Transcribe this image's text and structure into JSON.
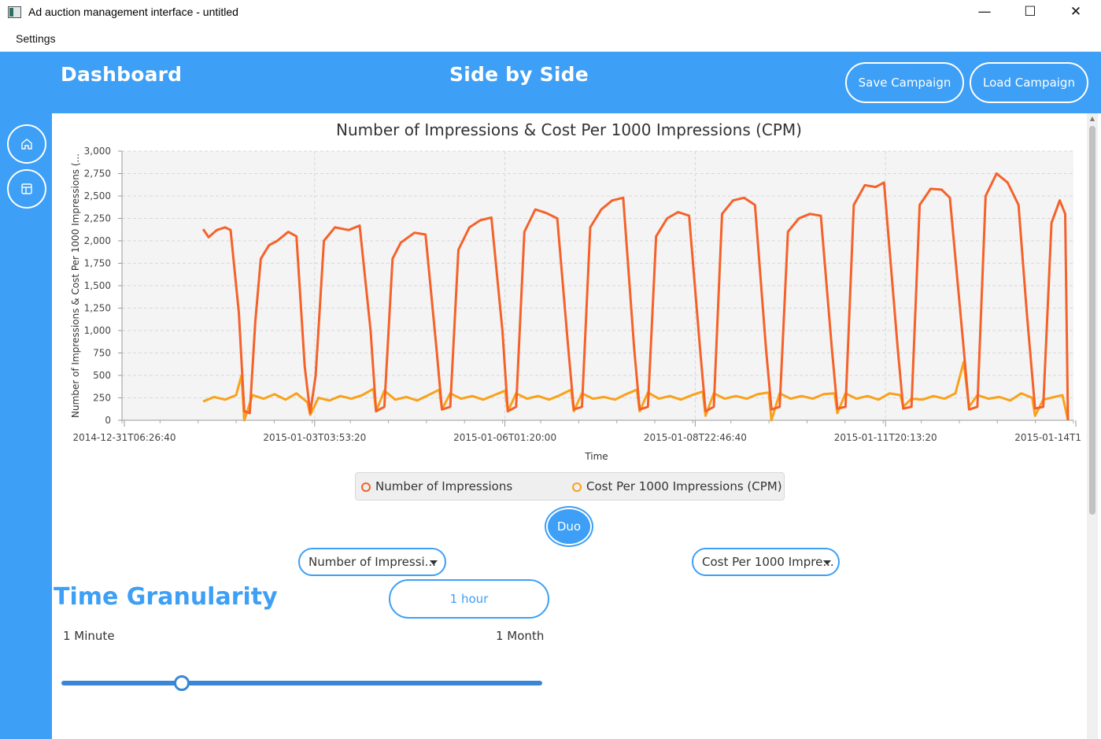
{
  "window": {
    "title": "Ad auction management interface - untitled",
    "minimize": "—",
    "maximize": "☐",
    "close": "✕"
  },
  "menu": {
    "settings": "Settings"
  },
  "header": {
    "left_title": "Dashboard",
    "center_title": "Side by Side",
    "save_label": "Save Campaign",
    "load_label": "Load Campaign"
  },
  "sidebar": {
    "items": [
      {
        "icon": "home-icon"
      },
      {
        "icon": "layout-icon"
      }
    ]
  },
  "chart_data": {
    "type": "line",
    "title": "Number of Impressions & Cost Per 1000 Impressions (CPM)",
    "xlabel": "Time",
    "ylabel": "Number of Impressions & Cost Per 1000 Impressions (...",
    "ylim": [
      0,
      3000
    ],
    "yticks": [
      0,
      250,
      500,
      750,
      1000,
      1250,
      1500,
      1750,
      2000,
      2250,
      2500,
      2750,
      3000
    ],
    "ytick_labels": [
      "0",
      "250",
      "500",
      "750",
      "1,000",
      "1,250",
      "1,500",
      "1,750",
      "2,000",
      "2,250",
      "2,500",
      "2,750",
      "3,000"
    ],
    "xlim": [
      "2014-12-31T06:26:40",
      "2015-01-14T17:00:00"
    ],
    "xtick_labels": [
      "2014-12-31T06:26:40",
      "2015-01-03T03:53:20",
      "2015-01-06T01:20:00",
      "2015-01-08T22:46:40",
      "2015-01-11T20:13:20",
      "2015-01-14T1"
    ],
    "grid": true,
    "legend_position": "bottom",
    "series": [
      {
        "name": "Number of Impressions",
        "color": "#f4622a",
        "points": [
          [
            "2015-01-01T12:00",
            2130
          ],
          [
            "2015-01-01T14:00",
            2040
          ],
          [
            "2015-01-01T17:00",
            2120
          ],
          [
            "2015-01-01T20:00",
            2150
          ],
          [
            "2015-01-01T22:00",
            2120
          ],
          [
            "2015-01-02T01:00",
            1200
          ],
          [
            "2015-01-02T03:00",
            100
          ],
          [
            "2015-01-02T05:00",
            80
          ],
          [
            "2015-01-02T07:00",
            1100
          ],
          [
            "2015-01-02T09:00",
            1800
          ],
          [
            "2015-01-02T12:00",
            1950
          ],
          [
            "2015-01-02T15:00",
            2000
          ],
          [
            "2015-01-02T19:00",
            2100
          ],
          [
            "2015-01-02T22:00",
            2050
          ],
          [
            "2015-01-03T01:00",
            600
          ],
          [
            "2015-01-03T03:00",
            80
          ],
          [
            "2015-01-03T05:00",
            500
          ],
          [
            "2015-01-03T08:00",
            2000
          ],
          [
            "2015-01-03T12:00",
            2150
          ],
          [
            "2015-01-03T17:00",
            2120
          ],
          [
            "2015-01-03T21:00",
            2170
          ],
          [
            "2015-01-04T01:00",
            1000
          ],
          [
            "2015-01-04T03:00",
            100
          ],
          [
            "2015-01-04T06:00",
            150
          ],
          [
            "2015-01-04T09:00",
            1800
          ],
          [
            "2015-01-04T12:00",
            1980
          ],
          [
            "2015-01-04T17:00",
            2090
          ],
          [
            "2015-01-04T21:00",
            2070
          ],
          [
            "2015-01-05T01:00",
            800
          ],
          [
            "2015-01-05T03:00",
            120
          ],
          [
            "2015-01-05T06:00",
            150
          ],
          [
            "2015-01-05T09:00",
            1900
          ],
          [
            "2015-01-05T13:00",
            2150
          ],
          [
            "2015-01-05T17:00",
            2230
          ],
          [
            "2015-01-05T21:00",
            2260
          ],
          [
            "2015-01-06T01:00",
            1000
          ],
          [
            "2015-01-06T03:00",
            100
          ],
          [
            "2015-01-06T06:00",
            150
          ],
          [
            "2015-01-06T09:00",
            2100
          ],
          [
            "2015-01-06T13:00",
            2350
          ],
          [
            "2015-01-06T17:00",
            2310
          ],
          [
            "2015-01-06T21:00",
            2250
          ],
          [
            "2015-01-07T01:00",
            800
          ],
          [
            "2015-01-07T03:00",
            120
          ],
          [
            "2015-01-07T06:00",
            150
          ],
          [
            "2015-01-07T09:00",
            2150
          ],
          [
            "2015-01-07T13:00",
            2350
          ],
          [
            "2015-01-07T17:00",
            2450
          ],
          [
            "2015-01-07T21:00",
            2480
          ],
          [
            "2015-01-08T01:00",
            800
          ],
          [
            "2015-01-08T03:00",
            120
          ],
          [
            "2015-01-08T06:00",
            150
          ],
          [
            "2015-01-08T09:00",
            2050
          ],
          [
            "2015-01-08T13:00",
            2250
          ],
          [
            "2015-01-08T17:00",
            2320
          ],
          [
            "2015-01-08T21:00",
            2280
          ],
          [
            "2015-01-09T01:00",
            800
          ],
          [
            "2015-01-09T03:00",
            100
          ],
          [
            "2015-01-09T06:00",
            150
          ],
          [
            "2015-01-09T09:00",
            2300
          ],
          [
            "2015-01-09T13:00",
            2450
          ],
          [
            "2015-01-09T17:00",
            2480
          ],
          [
            "2015-01-09T21:00",
            2400
          ],
          [
            "2015-01-10T01:00",
            800
          ],
          [
            "2015-01-10T03:00",
            120
          ],
          [
            "2015-01-10T06:00",
            150
          ],
          [
            "2015-01-10T09:00",
            2100
          ],
          [
            "2015-01-10T13:00",
            2250
          ],
          [
            "2015-01-10T17:00",
            2300
          ],
          [
            "2015-01-10T21:00",
            2280
          ],
          [
            "2015-01-11T01:00",
            800
          ],
          [
            "2015-01-11T03:00",
            130
          ],
          [
            "2015-01-11T06:00",
            150
          ],
          [
            "2015-01-11T09:00",
            2400
          ],
          [
            "2015-01-11T13:00",
            2620
          ],
          [
            "2015-01-11T17:00",
            2600
          ],
          [
            "2015-01-11T20:00",
            2650
          ],
          [
            "2015-01-12T01:00",
            800
          ],
          [
            "2015-01-12T03:00",
            130
          ],
          [
            "2015-01-12T06:00",
            150
          ],
          [
            "2015-01-12T09:00",
            2400
          ],
          [
            "2015-01-12T13:00",
            2580
          ],
          [
            "2015-01-12T17:00",
            2570
          ],
          [
            "2015-01-12T20:00",
            2480
          ],
          [
            "2015-01-13T01:00",
            800
          ],
          [
            "2015-01-13T03:00",
            120
          ],
          [
            "2015-01-13T06:00",
            150
          ],
          [
            "2015-01-13T09:00",
            2500
          ],
          [
            "2015-01-13T13:00",
            2750
          ],
          [
            "2015-01-13T17:00",
            2650
          ],
          [
            "2015-01-13T21:00",
            2400
          ],
          [
            "2015-01-14T00:00",
            1200
          ],
          [
            "2015-01-14T03:00",
            130
          ],
          [
            "2015-01-14T06:00",
            150
          ],
          [
            "2015-01-14T09:00",
            2200
          ],
          [
            "2015-01-14T12:00",
            2450
          ],
          [
            "2015-01-14T14:00",
            2300
          ],
          [
            "2015-01-14T15:00",
            0
          ]
        ]
      },
      {
        "name": "Cost Per 1000 Impressions (CPM)",
        "color": "#f9a11b",
        "points": [
          [
            "2015-01-01T12:00",
            210
          ],
          [
            "2015-01-01T16:00",
            260
          ],
          [
            "2015-01-01T20:00",
            230
          ],
          [
            "2015-01-02T00:00",
            280
          ],
          [
            "2015-01-02T02:00",
            500
          ],
          [
            "2015-01-02T03:00",
            0
          ],
          [
            "2015-01-02T06:00",
            280
          ],
          [
            "2015-01-02T10:00",
            240
          ],
          [
            "2015-01-02T14:00",
            290
          ],
          [
            "2015-01-02T18:00",
            230
          ],
          [
            "2015-01-02T22:00",
            300
          ],
          [
            "2015-01-03T02:00",
            200
          ],
          [
            "2015-01-03T03:00",
            60
          ],
          [
            "2015-01-03T06:00",
            250
          ],
          [
            "2015-01-03T10:00",
            220
          ],
          [
            "2015-01-03T14:00",
            270
          ],
          [
            "2015-01-03T18:00",
            240
          ],
          [
            "2015-01-03T22:00",
            280
          ],
          [
            "2015-01-04T02:00",
            350
          ],
          [
            "2015-01-04T03:00",
            100
          ],
          [
            "2015-01-04T06:00",
            330
          ],
          [
            "2015-01-04T10:00",
            230
          ],
          [
            "2015-01-04T14:00",
            260
          ],
          [
            "2015-01-04T18:00",
            220
          ],
          [
            "2015-01-04T22:00",
            280
          ],
          [
            "2015-01-05T02:00",
            340
          ],
          [
            "2015-01-05T03:00",
            120
          ],
          [
            "2015-01-05T06:00",
            300
          ],
          [
            "2015-01-05T10:00",
            240
          ],
          [
            "2015-01-05T14:00",
            270
          ],
          [
            "2015-01-05T18:00",
            230
          ],
          [
            "2015-01-05T22:00",
            280
          ],
          [
            "2015-01-06T02:00",
            330
          ],
          [
            "2015-01-06T03:00",
            100
          ],
          [
            "2015-01-06T06:00",
            300
          ],
          [
            "2015-01-06T10:00",
            240
          ],
          [
            "2015-01-06T14:00",
            270
          ],
          [
            "2015-01-06T18:00",
            230
          ],
          [
            "2015-01-06T22:00",
            280
          ],
          [
            "2015-01-07T02:00",
            340
          ],
          [
            "2015-01-07T03:00",
            100
          ],
          [
            "2015-01-07T06:00",
            300
          ],
          [
            "2015-01-07T10:00",
            240
          ],
          [
            "2015-01-07T14:00",
            260
          ],
          [
            "2015-01-07T18:00",
            230
          ],
          [
            "2015-01-07T22:00",
            290
          ],
          [
            "2015-01-08T02:00",
            340
          ],
          [
            "2015-01-08T03:00",
            100
          ],
          [
            "2015-01-08T06:00",
            310
          ],
          [
            "2015-01-08T10:00",
            240
          ],
          [
            "2015-01-08T14:00",
            270
          ],
          [
            "2015-01-08T18:00",
            230
          ],
          [
            "2015-01-08T22:00",
            280
          ],
          [
            "2015-01-09T02:00",
            320
          ],
          [
            "2015-01-09T03:00",
            50
          ],
          [
            "2015-01-09T06:00",
            300
          ],
          [
            "2015-01-09T10:00",
            240
          ],
          [
            "2015-01-09T14:00",
            270
          ],
          [
            "2015-01-09T18:00",
            240
          ],
          [
            "2015-01-09T22:00",
            290
          ],
          [
            "2015-01-10T02:00",
            310
          ],
          [
            "2015-01-10T03:00",
            0
          ],
          [
            "2015-01-10T06:00",
            300
          ],
          [
            "2015-01-10T10:00",
            240
          ],
          [
            "2015-01-10T14:00",
            270
          ],
          [
            "2015-01-10T18:00",
            240
          ],
          [
            "2015-01-10T22:00",
            290
          ],
          [
            "2015-01-11T02:00",
            300
          ],
          [
            "2015-01-11T03:00",
            80
          ],
          [
            "2015-01-11T06:00",
            300
          ],
          [
            "2015-01-11T10:00",
            240
          ],
          [
            "2015-01-11T14:00",
            270
          ],
          [
            "2015-01-11T18:00",
            230
          ],
          [
            "2015-01-11T22:00",
            300
          ],
          [
            "2015-01-12T02:00",
            280
          ],
          [
            "2015-01-12T03:00",
            150
          ],
          [
            "2015-01-12T06:00",
            240
          ],
          [
            "2015-01-12T10:00",
            230
          ],
          [
            "2015-01-12T14:00",
            270
          ],
          [
            "2015-01-12T18:00",
            240
          ],
          [
            "2015-01-12T22:00",
            300
          ],
          [
            "2015-01-13T01:00",
            650
          ],
          [
            "2015-01-13T03:00",
            150
          ],
          [
            "2015-01-13T06:00",
            280
          ],
          [
            "2015-01-13T10:00",
            240
          ],
          [
            "2015-01-13T14:00",
            260
          ],
          [
            "2015-01-13T18:00",
            220
          ],
          [
            "2015-01-13T22:00",
            300
          ],
          [
            "2015-01-14T02:00",
            250
          ],
          [
            "2015-01-14T03:00",
            50
          ],
          [
            "2015-01-14T06:00",
            230
          ],
          [
            "2015-01-14T10:00",
            260
          ],
          [
            "2015-01-14T13:00",
            280
          ],
          [
            "2015-01-14T15:00",
            0
          ]
        ]
      }
    ]
  },
  "controls": {
    "duo_label": "Duo",
    "left_metric": "Number of Impressi...",
    "right_metric": "Cost Per 1000 Impre...",
    "granularity_title": "Time Granularity",
    "granularity_value": "1 hour",
    "slider_min_label": "1 Minute",
    "slider_max_label": "1 Month",
    "slider_fraction": 0.25
  }
}
